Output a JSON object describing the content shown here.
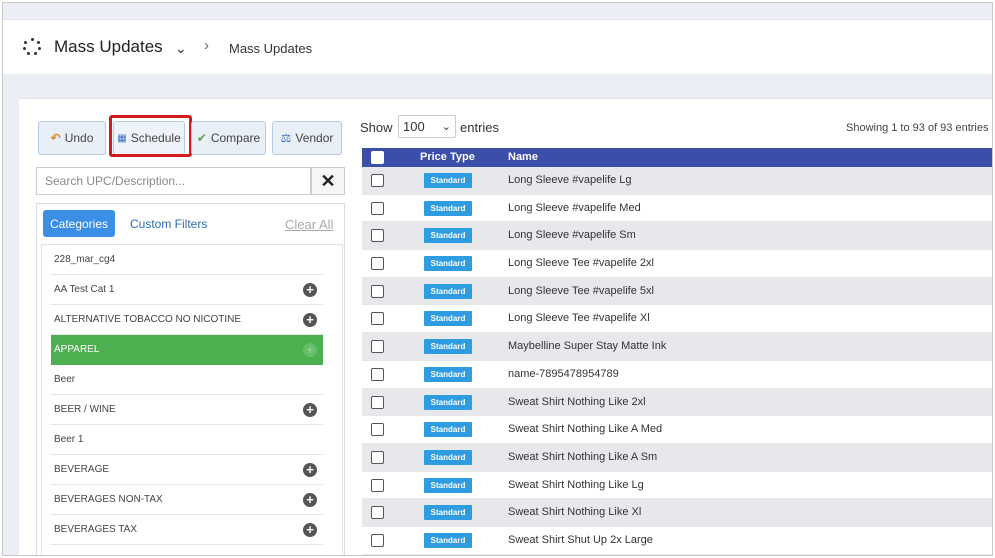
{
  "header": {
    "title": "Mass Updates",
    "breadcrumb": "Mass Updates"
  },
  "toolbar": {
    "undo_label": "Undo",
    "schedule_label": "Schedule",
    "compare_label": "Compare",
    "vendor_label": "Vendor"
  },
  "search": {
    "placeholder": "Search UPC/Description...",
    "value": ""
  },
  "filters": {
    "tab_categories": "Categories",
    "tab_custom": "Custom Filters",
    "clear_all": "Clear All"
  },
  "categories": [
    {
      "label": "228_mar_cg4",
      "has_add": false,
      "active": false
    },
    {
      "label": "AA Test Cat 1",
      "has_add": true,
      "active": false
    },
    {
      "label": "ALTERNATIVE TOBACCO NO NICOTINE",
      "has_add": true,
      "active": false
    },
    {
      "label": "APPAREL",
      "has_add": true,
      "active": true
    },
    {
      "label": "Beer",
      "has_add": false,
      "active": false
    },
    {
      "label": "BEER / WINE",
      "has_add": true,
      "active": false
    },
    {
      "label": "Beer 1",
      "has_add": false,
      "active": false
    },
    {
      "label": "BEVERAGE",
      "has_add": true,
      "active": false
    },
    {
      "label": "BEVERAGES NON-TAX",
      "has_add": true,
      "active": false
    },
    {
      "label": "BEVERAGES TAX",
      "has_add": true,
      "active": false
    }
  ],
  "table_controls": {
    "show_label": "Show",
    "page_size": "100",
    "entries_label": "entries",
    "info": "Showing 1 to 93 of 93 entries"
  },
  "table": {
    "columns": [
      "Price Type",
      "Name"
    ],
    "rows": [
      {
        "price_type": "Standard",
        "name": "Long Sleeve #vapelife Lg"
      },
      {
        "price_type": "Standard",
        "name": "Long Sleeve #vapelife Med"
      },
      {
        "price_type": "Standard",
        "name": "Long Sleeve #vapelife Sm"
      },
      {
        "price_type": "Standard",
        "name": "Long Sleeve Tee #vapelife 2xl"
      },
      {
        "price_type": "Standard",
        "name": "Long Sleeve Tee #vapelife 5xl"
      },
      {
        "price_type": "Standard",
        "name": "Long Sleeve Tee #vapelife Xl"
      },
      {
        "price_type": "Standard",
        "name": "Maybelline Super Stay Matte Ink"
      },
      {
        "price_type": "Standard",
        "name": "name-7895478954789"
      },
      {
        "price_type": "Standard",
        "name": "Sweat Shirt Nothing Like 2xl"
      },
      {
        "price_type": "Standard",
        "name": "Sweat Shirt Nothing Like A Med"
      },
      {
        "price_type": "Standard",
        "name": "Sweat Shirt Nothing Like A Sm"
      },
      {
        "price_type": "Standard",
        "name": "Sweat Shirt Nothing Like Lg"
      },
      {
        "price_type": "Standard",
        "name": "Sweat Shirt Nothing Like Xl"
      },
      {
        "price_type": "Standard",
        "name": "Sweat Shirt Shut Up 2x Large"
      }
    ]
  },
  "colors": {
    "accent": "#3a8ee6",
    "active_category": "#4caf50",
    "table_header": "#3b4ea8",
    "badge": "#2e9ce0",
    "highlight": "#d41b1b"
  }
}
